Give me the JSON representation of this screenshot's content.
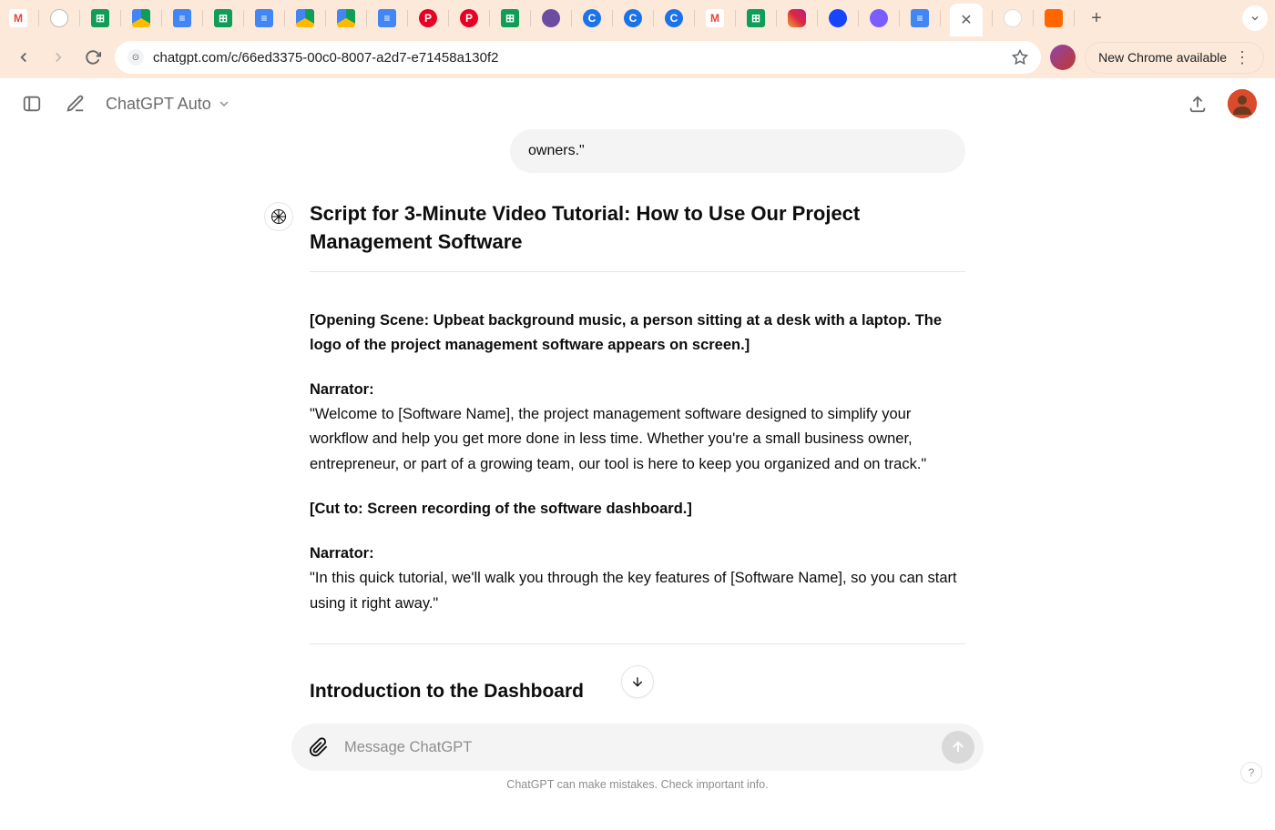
{
  "browser": {
    "url": "chatgpt.com/c/66ed3375-00c0-8007-a2d7-e71458a130f2",
    "update_label": "New Chrome available"
  },
  "app_header": {
    "model_label": "ChatGPT Auto"
  },
  "conversation": {
    "user_tail": "owners.\"",
    "assistant": {
      "title": "Script for 3-Minute Video Tutorial: How to Use Our Project Management Software",
      "p1_bold": "[Opening Scene: Upbeat background music, a person sitting at a desk with a laptop. The logo of the project management software appears on screen.]",
      "p2_label": "Narrator:",
      "p2_body": "\"Welcome to [Software Name], the project management software designed to simplify your workflow and help you get more done in less time. Whether you're a small business owner, entrepreneur, or part of a growing team, our tool is here to keep you organized and on track.\"",
      "p3_bold": "[Cut to: Screen recording of the software dashboard.]",
      "p4_label": "Narrator:",
      "p4_body": "\"In this quick tutorial, we'll walk you through the key features of [Software Name], so you can start using it right away.\"",
      "h4": "Introduction to the Dashboard"
    }
  },
  "composer": {
    "placeholder": "Message ChatGPT",
    "disclaimer": "ChatGPT can make mistakes. Check important info."
  }
}
